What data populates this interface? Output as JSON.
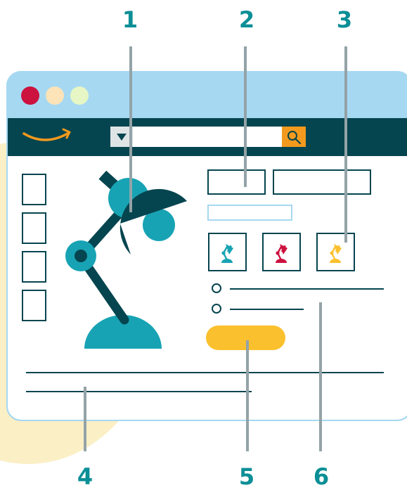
{
  "colors": {
    "accent_teal": "#17a3b4",
    "dark_teal": "#05454f",
    "header_blue": "#a6d8f2",
    "browser_bar": "#05454f",
    "search_orange": "#f39a1e",
    "callout_line": "#93a3a7",
    "callout_number": "#0b8f96",
    "cream_blob": "#fbefc6",
    "dot_red": "#cc123f",
    "dot_peach": "#fce3b8",
    "dot_green": "#e6f6c4",
    "button_yellow": "#fbc02d",
    "swatch_teal": "#17a3b4",
    "swatch_red": "#cc123f",
    "swatch_yellow": "#fbc02d"
  },
  "icons": {
    "logo": "amazon-smile-icon",
    "dropdown": "dropdown-caret-icon",
    "search": "search-icon",
    "hero": "desk-lamp-icon",
    "swatch": "desk-lamp-icon"
  },
  "callouts": [
    "1",
    "2",
    "3",
    "4",
    "5",
    "6"
  ]
}
